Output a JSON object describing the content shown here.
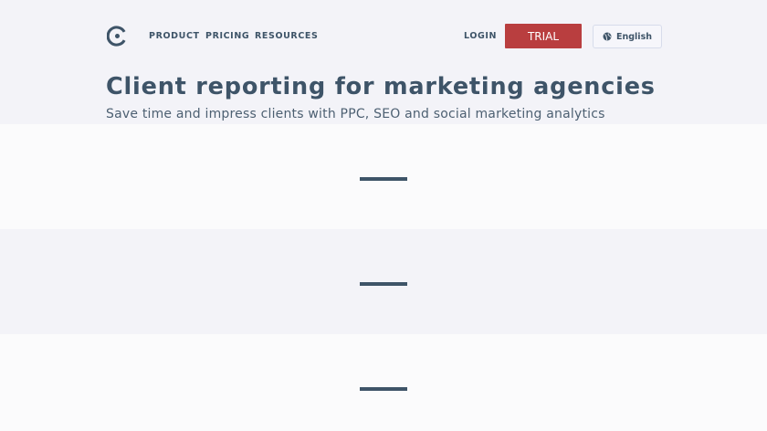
{
  "nav": {
    "links": [
      "PRODUCT",
      "PRICING",
      "RESOURCES"
    ],
    "login": "LOGIN",
    "trial": "TRIAL",
    "language": "English"
  },
  "hero": {
    "title": "Client reporting for marketing agencies",
    "subtitle": "Save time and impress clients with PPC, SEO and social marketing analytics"
  },
  "colors": {
    "background": "#f3f3f8",
    "band_light": "#fbfbfc",
    "text": "#3e5468",
    "accent": "#b93e3f"
  },
  "icons": {
    "logo": "logo-icon",
    "language": "globe-icon"
  },
  "loading_sections": 3
}
